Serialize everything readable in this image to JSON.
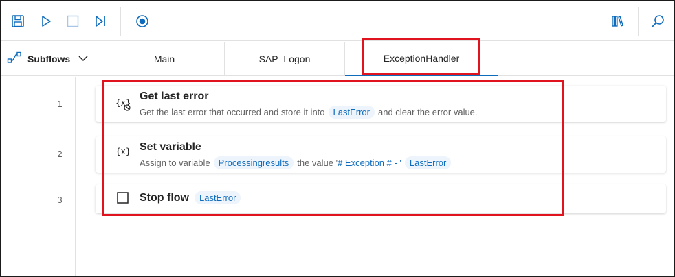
{
  "toolbar": {
    "icons": [
      "save-icon",
      "run-icon",
      "stop-icon",
      "run-next-action-icon",
      "record-icon",
      "actions-library-icon",
      "search-icon"
    ],
    "accent": "#0f6cbd"
  },
  "tabs": {
    "subflows_label": "Subflows",
    "items": [
      {
        "label": "Main"
      },
      {
        "label": "SAP_Logon"
      },
      {
        "label": "ExceptionHandler",
        "active": true
      }
    ]
  },
  "actions": [
    {
      "line": "1",
      "title": "Get last error",
      "desc_prefix": "Get the last error that occurred and store it into",
      "var1": "LastError",
      "desc_suffix": "and clear the error value.",
      "icon": "get-last-error-icon"
    },
    {
      "line": "2",
      "title": "Set variable",
      "desc_prefix": "Assign to variable",
      "var1": "Processingresults",
      "desc_mid": "the value '",
      "literal": "# Exception # - '",
      "var2": "LastError",
      "icon": "variable-icon"
    },
    {
      "line": "3",
      "title": "Stop flow",
      "var1": "LastError",
      "icon": "stop-flow-icon"
    }
  ],
  "highlight_color": "#e0141e"
}
